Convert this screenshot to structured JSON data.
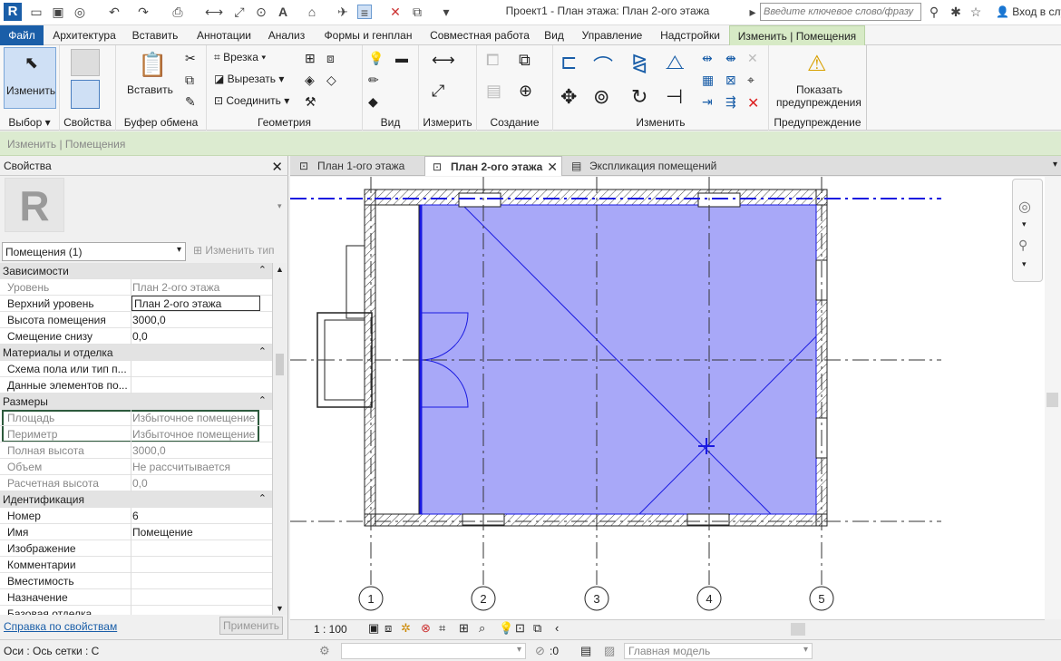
{
  "app": {
    "logo": "R",
    "title": "Проект1 - План этажа: План 2-ого этажа",
    "search_placeholder": "Введите ключевое слово/фразу",
    "login": "Вход в слу"
  },
  "ribbon_tabs": [
    "Файл",
    "Архитектура",
    "Вставить",
    "Аннотации",
    "Анализ",
    "Формы и генплан",
    "Совместная работа",
    "Вид",
    "Управление",
    "Надстройки",
    "Изменить | Помещения"
  ],
  "ribbon": {
    "modify": "Изменить",
    "select": "Выбор",
    "properties": "Свойства",
    "paste": "Вставить",
    "clipboard": "Буфер обмена",
    "cut_in": "Врезка",
    "cut": "Вырезать",
    "join": "Соединить",
    "geometry": "Геометрия",
    "view": "Вид",
    "measure": "Измерить",
    "create": "Создание",
    "modify_panel": "Изменить",
    "show_warnings_1": "Показать",
    "show_warnings_2": "предупреждения",
    "warning_panel": "Предупреждение"
  },
  "context_bar": "Изменить | Помещения",
  "properties": {
    "title": "Свойства",
    "type_selector": "Помещения (1)",
    "edit_type": "Изменить тип",
    "sections": [
      {
        "name": "Зависимости"
      },
      {
        "name": "Материалы и отделка"
      },
      {
        "name": "Размеры"
      },
      {
        "name": "Идентификация"
      }
    ],
    "rows": {
      "level": {
        "k": "Уровень",
        "v": "План 2-ого этажа"
      },
      "upper_level": {
        "k": "Верхний уровень",
        "v": "План 2-ого этажа"
      },
      "room_height": {
        "k": "Высота помещения",
        "v": "3000,0"
      },
      "base_offset": {
        "k": "Смещение снизу",
        "v": "0,0"
      },
      "floor_scheme": {
        "k": "Схема пола или тип п...",
        "v": ""
      },
      "elements_data": {
        "k": "Данные элементов по...",
        "v": ""
      },
      "area": {
        "k": "Площадь",
        "v": "Избыточное помещение"
      },
      "perimeter": {
        "k": "Периметр",
        "v": "Избыточное помещение"
      },
      "full_height": {
        "k": "Полная высота",
        "v": "3000,0"
      },
      "volume": {
        "k": "Объем",
        "v": "Не рассчитывается"
      },
      "calc_height": {
        "k": "Расчетная высота",
        "v": "0,0"
      },
      "number": {
        "k": "Номер",
        "v": "6"
      },
      "name": {
        "k": "Имя",
        "v": "Помещение"
      },
      "image": {
        "k": "Изображение",
        "v": ""
      },
      "comments": {
        "k": "Комментарии",
        "v": ""
      },
      "capacity": {
        "k": "Вместимость",
        "v": ""
      },
      "purpose": {
        "k": "Назначение",
        "v": ""
      },
      "base_finish": {
        "k": "Базовая отделка",
        "v": ""
      }
    },
    "help_link": "Справка по свойствам",
    "apply": "Применить"
  },
  "view_tabs": [
    "План 1-ого этажа",
    "План 2-ого этажа",
    "Экспликация помещений"
  ],
  "grid_labels": [
    "1",
    "2",
    "3",
    "4",
    "5"
  ],
  "scale": "1 : 100",
  "status": {
    "text": "Оси : Ось сетки : С",
    "count": ":0",
    "model": "Главная модель"
  },
  "colors": {
    "room_fill": "#a8a8f8",
    "grid_line": "#1a1ae0",
    "accent": "#1a5ea8"
  }
}
